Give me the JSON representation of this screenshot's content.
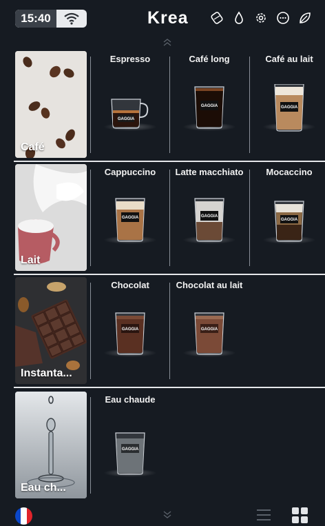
{
  "status": {
    "time": "15:40"
  },
  "brand": "Krea",
  "top_icons": [
    "coffee-beans-icon",
    "water-drop-icon",
    "settings-gear-icon",
    "chat-bubble-icon",
    "leaf-icon"
  ],
  "categories": [
    {
      "label": "Café",
      "image": "coffee-beans-photo",
      "drinks": [
        {
          "name": "Espresso",
          "cup": "espresso-glass"
        },
        {
          "name": "Café long",
          "cup": "black-coffee-glass"
        },
        {
          "name": "Café au lait",
          "cup": "milk-coffee-glass"
        }
      ]
    },
    {
      "label": "Lait",
      "image": "milk-splash-photo",
      "drinks": [
        {
          "name": "Cappuccino",
          "cup": "cappuccino-glass"
        },
        {
          "name": "Latte macchiato",
          "cup": "latte-glass"
        },
        {
          "name": "Mocaccino",
          "cup": "mocaccino-glass"
        }
      ]
    },
    {
      "label": "Instanta...",
      "image": "chocolate-bar-photo",
      "drinks": [
        {
          "name": "Chocolat",
          "cup": "chocolate-glass"
        },
        {
          "name": "Chocolat au lait",
          "cup": "milk-chocolate-glass"
        }
      ]
    },
    {
      "label": "Eau ch...",
      "image": "water-drop-photo",
      "drinks": [
        {
          "name": "Eau chaude",
          "cup": "hot-water-glass"
        }
      ]
    }
  ],
  "cup_brand": "GAGGIA",
  "bottom": {
    "language_flag": "france-flag-icon",
    "view_modes": [
      "list-view-icon",
      "grid-view-icon"
    ],
    "active_view": "grid"
  },
  "colors": {
    "background": "#161b22",
    "divider": "#e6e8eb",
    "separator": "#8a9099",
    "flag_blue": "#0b47c8",
    "flag_white": "#ffffff",
    "flag_red": "#e1242b"
  }
}
